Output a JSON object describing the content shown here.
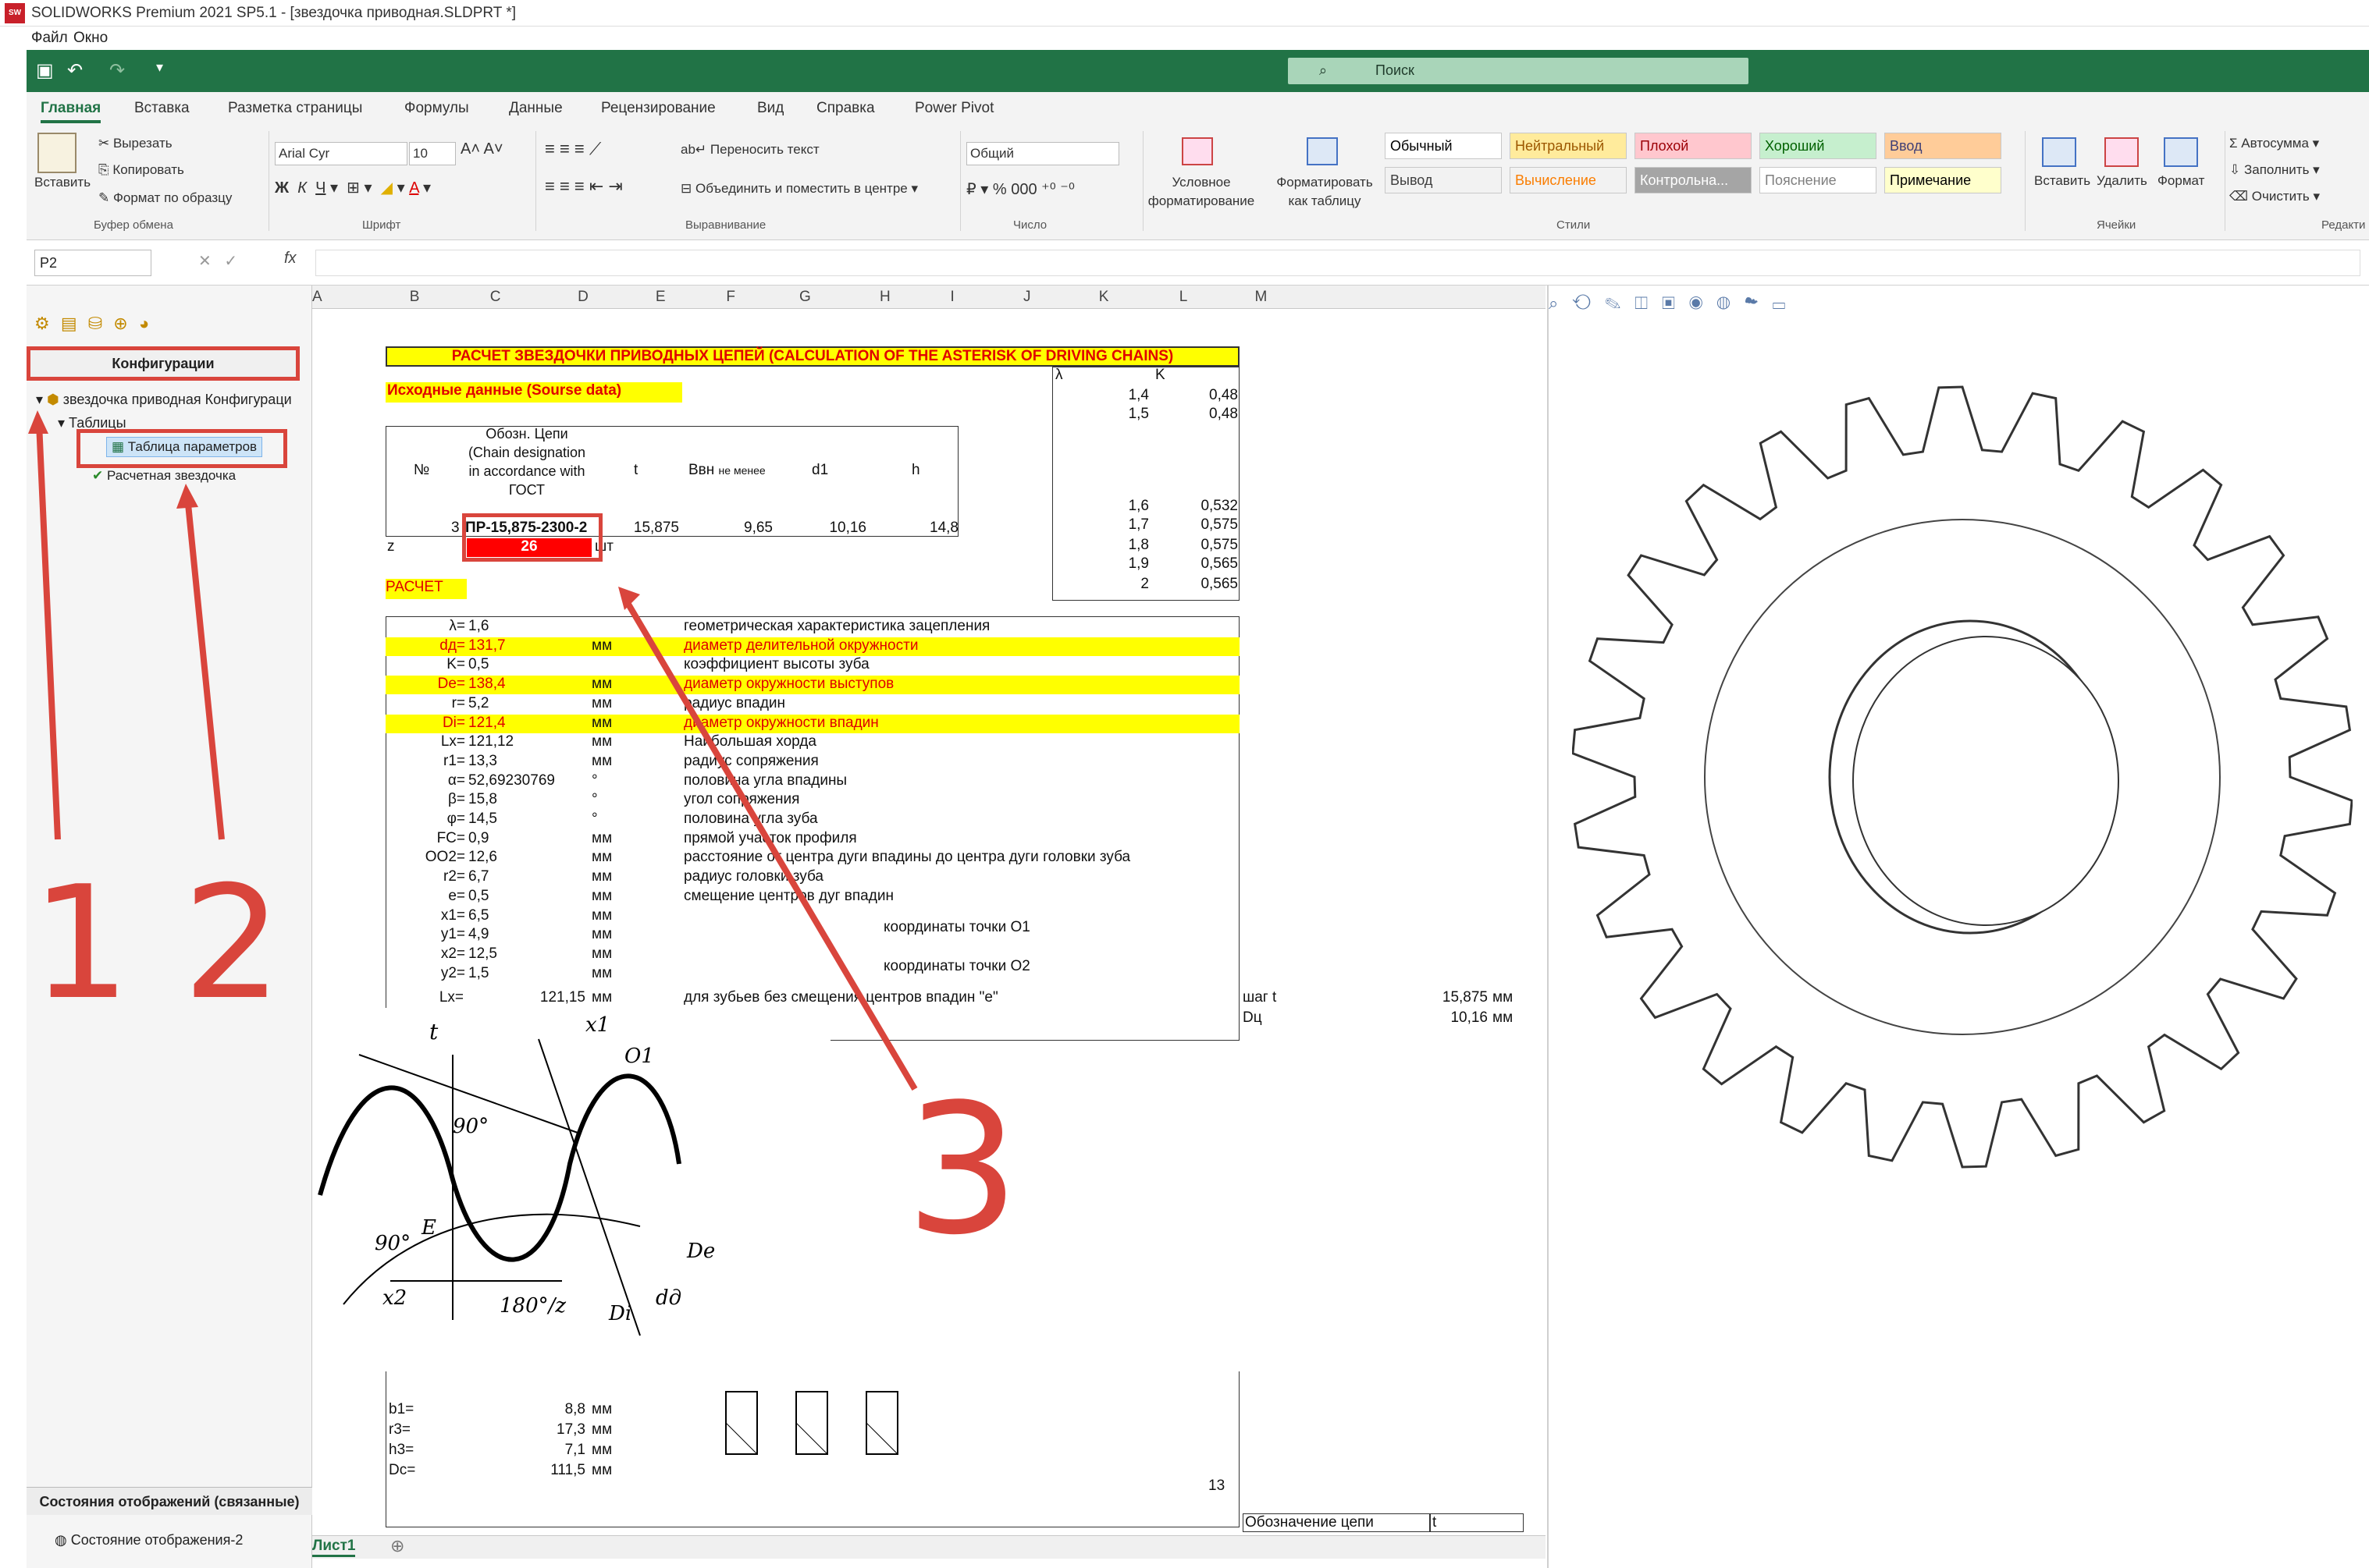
{
  "window": {
    "title": "SOLIDWORKS Premium 2021 SP5.1 - [звездочка приводная.SLDPRT *]",
    "menu": [
      "Файл",
      "Окно"
    ]
  },
  "excel": {
    "search_placeholder": "Поиск",
    "tabs": [
      "Главная",
      "Вставка",
      "Разметка страницы",
      "Формулы",
      "Данные",
      "Рецензирование",
      "Вид",
      "Справка",
      "Power Pivot"
    ],
    "active_tab": "Главная",
    "clipboard": {
      "paste": "Вставить",
      "cut": "Вырезать",
      "copy": "Копировать",
      "format_painter": "Формат по образцу",
      "group": "Буфер обмена"
    },
    "font": {
      "name": "Arial Cyr",
      "size": "10",
      "group": "Шрифт"
    },
    "alignment": {
      "wrap": "Переносить текст",
      "merge": "Объединить и поместить в центре",
      "group": "Выравнивание"
    },
    "number": {
      "format": "Общий",
      "group": "Число"
    },
    "styles": {
      "conditional": "Условное форматирование",
      "as_table": "Форматировать как таблицу",
      "cells": [
        {
          "label": "Обычный",
          "bg": "#ffffff",
          "fg": "#000000"
        },
        {
          "label": "Нейтральный",
          "bg": "#ffeb9c",
          "fg": "#9c5700"
        },
        {
          "label": "Плохой",
          "bg": "#ffc7ce",
          "fg": "#9c0006"
        },
        {
          "label": "Хороший",
          "bg": "#c6efce",
          "fg": "#006100"
        },
        {
          "label": "Ввод",
          "bg": "#ffcc99",
          "fg": "#3f3f76"
        },
        {
          "label": "Вывод",
          "bg": "#f2f2f2",
          "fg": "#3f3f3f"
        },
        {
          "label": "Вычисление",
          "bg": "#f2f2f2",
          "fg": "#fa7d00"
        },
        {
          "label": "Контрольна...",
          "bg": "#a5a5a5",
          "fg": "#ffffff"
        },
        {
          "label": "Пояснение",
          "bg": "#ffffff",
          "fg": "#7f7f7f"
        },
        {
          "label": "Примечание",
          "bg": "#ffffcc",
          "fg": "#000000"
        }
      ],
      "group": "Стили"
    },
    "cells_group": {
      "insert": "Вставить",
      "delete": "Удалить",
      "format": "Формат",
      "group": "Ячейки"
    },
    "editing": {
      "autosum": "Автосумма",
      "fill": "Заполнить",
      "clear": "Очистить",
      "group": "Редакти"
    },
    "namebox": "P2",
    "fx": "fx",
    "sheet_tab": "Лист1"
  },
  "sw_panel": {
    "header": "Конфигурации",
    "tree": [
      "звездочка приводная Конфигураци",
      "Таблицы",
      "Таблица параметров",
      "Расчетная звездочка"
    ],
    "display_states_header": "Состояния отображений (связанные)",
    "display_state": "Состояние отображения-2"
  },
  "sheet": {
    "columns": [
      "A",
      "B",
      "C",
      "D",
      "E",
      "F",
      "G",
      "H",
      "I",
      "J",
      "K",
      "L",
      "M"
    ],
    "title": "РАСЧЕТ ЗВЕЗДОЧКИ ПРИВОДНЫХ ЦЕПЕЙ (CALCULATION OF THE ASTERISK OF DRIVING CHAINS)",
    "source_label": "Исходные данные (Sourse data)",
    "table_head": {
      "no": "№",
      "designation": "Обозн. Цепи (Chain designation in accordance with ГОСТ",
      "t": "t",
      "bvn": "Ввн",
      "bvn_note": "не менее",
      "d1": "d1",
      "h": "h"
    },
    "table_row": {
      "no": "3",
      "designation": "ПР-15,875-2300-2",
      "t": "15,875",
      "bvn": "9,65",
      "d1": "10,16",
      "h": "14,8"
    },
    "z_label": "z",
    "z_value": "26",
    "z_unit": "шт",
    "lambda_table": {
      "head": [
        "λ",
        "K"
      ],
      "rows": [
        [
          "1,4",
          "0,48"
        ],
        [
          "1,5",
          "0,48"
        ],
        [
          "1,6",
          "0,532"
        ],
        [
          "1,7",
          "0,575"
        ],
        [
          "1,8",
          "0,575"
        ],
        [
          "1,9",
          "0,565"
        ],
        [
          "2",
          "0,565"
        ]
      ]
    },
    "calc_label": "РАСЧЕТ",
    "calc_rows": [
      {
        "label": "λ=",
        "value": "1,6",
        "unit": "",
        "desc": "геометрическая характеристика зацепления",
        "hl": false
      },
      {
        "label": "dд=",
        "value": "131,7",
        "unit": "мм",
        "desc": "диаметр делительной окружности",
        "hl": true
      },
      {
        "label": "K=",
        "value": "0,5",
        "unit": "",
        "desc": "коэффициент высоты зуба",
        "hl": false
      },
      {
        "label": "De=",
        "value": "138,4",
        "unit": "мм",
        "desc": "диаметр окружности выступов",
        "hl": true
      },
      {
        "label": "r=",
        "value": "5,2",
        "unit": "мм",
        "desc": "радиус впадин",
        "hl": false
      },
      {
        "label": "Di=",
        "value": "121,4",
        "unit": "мм",
        "desc": "диаметр окружности впадин",
        "hl": true
      },
      {
        "label": "Lx=",
        "value": "121,12",
        "unit": "мм",
        "desc": "Наибольшая хорда",
        "hl": false
      },
      {
        "label": "r1=",
        "value": "13,3",
        "unit": "мм",
        "desc": "радиус сопряжения",
        "hl": false
      },
      {
        "label": "α=",
        "value": "52,69230769",
        "unit": "°",
        "desc": "половина угла впадины",
        "hl": false
      },
      {
        "label": "β=",
        "value": "15,8",
        "unit": "°",
        "desc": "угол сопряжения",
        "hl": false
      },
      {
        "label": "φ=",
        "value": "14,5",
        "unit": "°",
        "desc": "половина угла зуба",
        "hl": false
      },
      {
        "label": "FC=",
        "value": "0,9",
        "unit": "мм",
        "desc": "прямой участок профиля",
        "hl": false
      },
      {
        "label": "OO2=",
        "value": "12,6",
        "unit": "мм",
        "desc": "расстояние от центра дуги впадины до центра дуги головки зуба",
        "hl": false
      },
      {
        "label": "r2=",
        "value": "6,7",
        "unit": "мм",
        "desc": "радиус головки зуба",
        "hl": false
      },
      {
        "label": "e=",
        "value": "0,5",
        "unit": "мм",
        "desc": "смещение центров дуг впадин",
        "hl": false
      },
      {
        "label": "x1=",
        "value": "6,5",
        "unit": "мм",
        "desc": "",
        "hl": false
      },
      {
        "label": "y1=",
        "value": "4,9",
        "unit": "мм",
        "desc": "",
        "hl": false
      },
      {
        "label": "x2=",
        "value": "12,5",
        "unit": "мм",
        "desc": "",
        "hl": false
      },
      {
        "label": "y2=",
        "value": "1,5",
        "unit": "мм",
        "desc": "",
        "hl": false
      }
    ],
    "coord_o1": "координаты точки О1",
    "coord_o2": "координаты точки О2",
    "lx_row": {
      "label": "Lx=",
      "value": "121,15",
      "unit": "мм",
      "desc": "для зубьев без смещения центров впадин \"е\""
    },
    "side": [
      {
        "label": "шаг t",
        "value": "15,875",
        "unit": "мм"
      },
      {
        "label": "Dц",
        "value": "10,16",
        "unit": "мм"
      }
    ],
    "bottom_rows": [
      {
        "label": "b1=",
        "value": "8,8",
        "unit": "мм"
      },
      {
        "label": "r3=",
        "value": "17,3",
        "unit": "мм"
      },
      {
        "label": "h3=",
        "value": "7,1",
        "unit": "мм"
      },
      {
        "label": "Dc=",
        "value": "111,5",
        "unit": "мм"
      }
    ],
    "page_num": "13",
    "chain_label": "Обозначение цепи",
    "chain_t": "t"
  },
  "annotations": [
    "1",
    "2",
    "3"
  ],
  "colors": {
    "excel_green": "#217346",
    "annot_red": "#d9453c",
    "highlight_yellow": "#ffff00",
    "cell_red": "#ff0000"
  }
}
